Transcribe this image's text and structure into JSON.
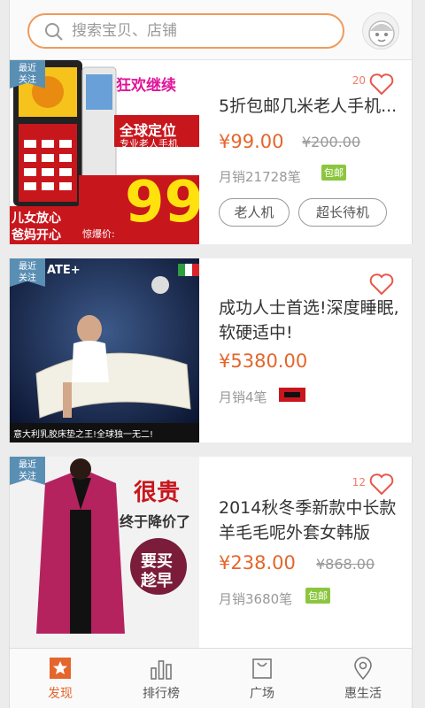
{
  "search": {
    "placeholder": "搜索宝贝、店铺"
  },
  "ribbon_text": [
    "最近",
    "关注"
  ],
  "products": [
    {
      "like_count": "20",
      "title": "5折包邮几米老人手机...",
      "price": "¥99.00",
      "old_price": "¥200.00",
      "sales": "月销21728笔",
      "badge": "包邮",
      "tags": [
        "老人机",
        "超长待机"
      ],
      "image_text": {
        "top": "狂欢继续",
        "mid1": "全球定位",
        "mid2": "专业老人手机",
        "bottom1": "儿女放心",
        "bottom2": "爸妈开心",
        "promo": "惊爆价:",
        "big": "99"
      }
    },
    {
      "like_count": "",
      "title": "成功人士首选!深度睡眠,软硬适中!",
      "price": "¥5380.00",
      "old_price": "",
      "sales": "月销4笔",
      "badge": "",
      "tags": [],
      "image_text": {
        "top": "ATE+",
        "bottom": "意大利乳胶床垫之王!全球独一无二!"
      }
    },
    {
      "like_count": "12",
      "title": "2014秋冬季新款中长款羊毛毛呢外套女韩版",
      "price": "¥238.00",
      "old_price": "¥868.00",
      "sales": "月销3680笔",
      "badge": "包邮",
      "tags": [],
      "image_text": {
        "t1": "很贵",
        "t2": "终于降价了",
        "t3": "要买",
        "t4": "趁早"
      }
    }
  ],
  "tabs": [
    {
      "label": "发现",
      "icon": "star-icon",
      "active": true
    },
    {
      "label": "排行榜",
      "icon": "bar-chart-icon",
      "active": false
    },
    {
      "label": "广场",
      "icon": "shopping-bag-icon",
      "active": false
    },
    {
      "label": "惠生活",
      "icon": "location-pin-icon",
      "active": false
    }
  ],
  "colors": {
    "accent": "#e4662c",
    "search_border": "#f19a59",
    "ribbon": "#5a8fb4",
    "badge": "#8cc63f"
  }
}
